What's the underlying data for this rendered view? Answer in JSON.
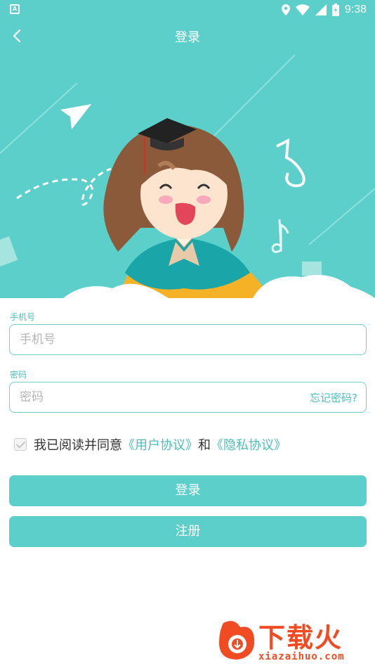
{
  "status_bar": {
    "app_icon_letter": "A",
    "time": "9:38",
    "icons": [
      "location-icon",
      "wifi-icon",
      "signal-icon",
      "battery-icon"
    ]
  },
  "header": {
    "title": "登录",
    "back_icon": "chevron-left-icon"
  },
  "form": {
    "phone": {
      "label": "手机号",
      "placeholder": "手机号",
      "value": ""
    },
    "password": {
      "label": "密码",
      "placeholder": "密码",
      "value": "",
      "forgot_label": "忘记密码?"
    }
  },
  "agreement": {
    "checked": true,
    "prefix": "我已阅读并同意",
    "user_agreement": "《用户协议》",
    "conjunction": "和",
    "privacy_policy": "《隐私协议》"
  },
  "buttons": {
    "login_label": "登录",
    "register_label": "注册"
  },
  "watermark": {
    "brand": "下载火",
    "url": "xiazaihuo.com"
  },
  "colors": {
    "primary": "#5ccfcb",
    "accent_text": "#4cbfbb",
    "watermark": "#f04b23"
  }
}
